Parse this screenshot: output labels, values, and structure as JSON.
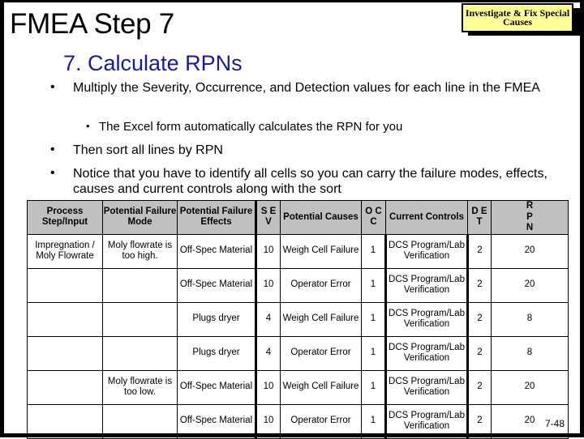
{
  "slide": {
    "title": "FMEA Step 7",
    "badge": "Investigate & Fix Special Causes",
    "subtitle": "7. Calculate RPNs",
    "bullets": [
      "Multiply the Severity, Occurrence, and Detection values for each line in the FMEA",
      "The Excel form automatically calculates the RPN for you",
      "Then sort all lines by RPN",
      "Notice that you have to identify all cells so you can carry the failure modes, effects, causes and current controls along with the sort"
    ],
    "bullet_glyph": "•",
    "page_number": "7-48"
  },
  "table": {
    "headers": {
      "process": "Process Step/Input",
      "mode": "Potential Failure Mode",
      "effects": "Potential Failure Effects",
      "sev": "S E V",
      "causes": "Potential Causes",
      "occ": "O C C",
      "controls": "Current Controls",
      "det": "D E T",
      "rpn": "R P N"
    },
    "rows": [
      {
        "process": "Impregnation / Moly Flowrate",
        "mode": "Moly flowrate is too high.",
        "effects": "Off-Spec Material",
        "sev": "10",
        "causes": "Weigh Cell Failure",
        "occ": "1",
        "controls": "DCS Program/Lab Verification",
        "det": "2",
        "rpn": "20"
      },
      {
        "process": "",
        "mode": "",
        "effects": "Off-Spec Material",
        "sev": "10",
        "causes": "Operator Error",
        "occ": "1",
        "controls": "DCS Program/Lab Verification",
        "det": "2",
        "rpn": "20"
      },
      {
        "process": "",
        "mode": "",
        "effects": "Plugs dryer",
        "sev": "4",
        "causes": "Weigh Cell Failure",
        "occ": "1",
        "controls": "DCS Program/Lab Verification",
        "det": "2",
        "rpn": "8"
      },
      {
        "process": "",
        "mode": "",
        "effects": "Plugs dryer",
        "sev": "4",
        "causes": "Operator Error",
        "occ": "1",
        "controls": "DCS Program/Lab Verification",
        "det": "2",
        "rpn": "8"
      },
      {
        "process": "",
        "mode": "Moly flowrate is too low.",
        "effects": "Off-Spec Material",
        "sev": "10",
        "causes": "Weigh Cell Failure",
        "occ": "1",
        "controls": "DCS Program/Lab Verification",
        "det": "2",
        "rpn": "20"
      },
      {
        "process": "",
        "mode": "",
        "effects": "Off-Spec Material",
        "sev": "10",
        "causes": "Operator Error",
        "occ": "1",
        "controls": "DCS Program/Lab Verification",
        "det": "2",
        "rpn": "20"
      }
    ]
  },
  "colors": {
    "subtitle": "#1a1a99",
    "badge_bg": "#ffff99",
    "header_bg": "#c0c0c0"
  }
}
